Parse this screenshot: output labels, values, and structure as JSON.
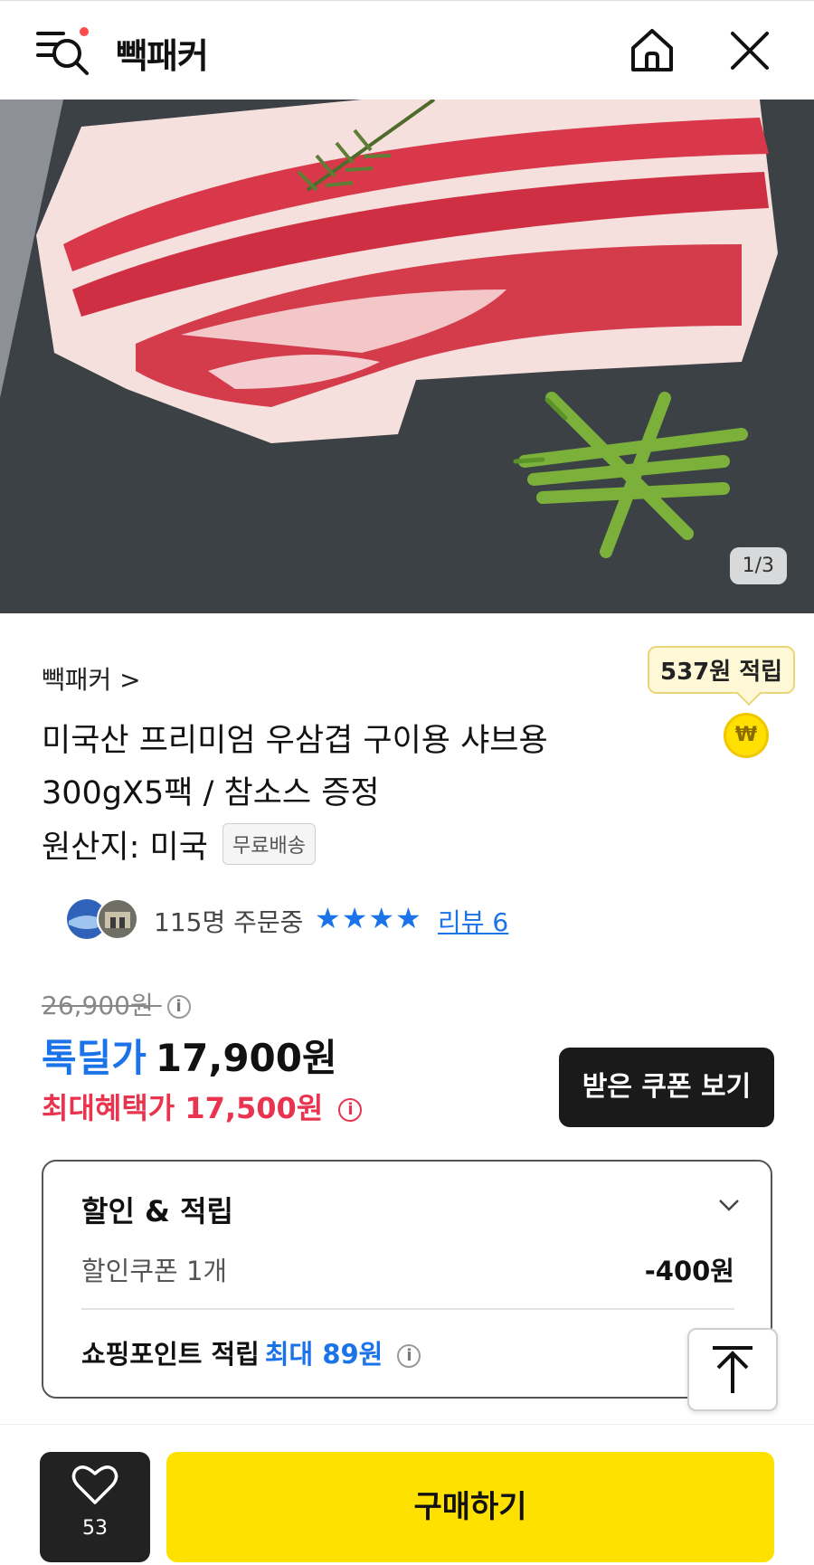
{
  "header": {
    "brand": "빽패커"
  },
  "hero": {
    "counter": "1/3"
  },
  "product": {
    "seller_link": "빽패커 >",
    "points_badge": "537원 적립",
    "won_symbol": "₩",
    "title": "미국산 프리미엄 우삼겹 구이용 샤브용 300gX5팩 / 참소스 증정",
    "origin": "원산지: 미국",
    "free_shipping": "무료배송",
    "orders_text": "115명 주문중",
    "stars": "★★★★",
    "review_link": "리뷰 6"
  },
  "price": {
    "original": "26,900원",
    "deal_label": "톡딜가",
    "deal_value": "17,900원",
    "best_label": "최대혜택가 17,500원",
    "info_symbol": "i",
    "coupon_button": "받은 쿠폰 보기"
  },
  "benefit": {
    "title": "할인 & 적립",
    "coupon_label": "할인쿠폰 1개",
    "coupon_value": "-400원",
    "points_label": "쇼핑포인트 적립",
    "points_value": "최대 89원"
  },
  "bottom": {
    "like_count": "53",
    "buy_label": "구매하기"
  }
}
